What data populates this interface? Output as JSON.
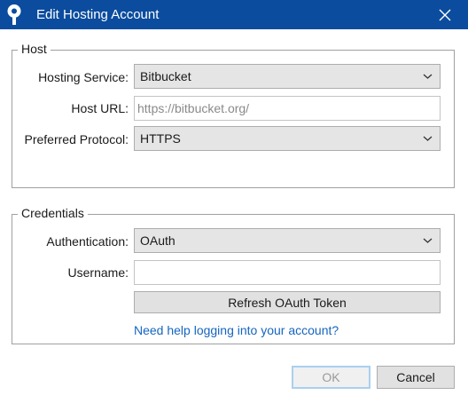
{
  "window": {
    "title": "Edit Hosting Account"
  },
  "icons": {
    "app": "sourcetree-icon",
    "close": "close-icon",
    "dropdown": "chevron-down-icon"
  },
  "colors": {
    "titlebar": "#0b4c9e",
    "link": "#1565c0",
    "ok_border": "#a9d0ef"
  },
  "host_group": {
    "legend": "Host",
    "hosting_service": {
      "label": "Hosting Service:",
      "value": "Bitbucket"
    },
    "host_url": {
      "label": "Host URL:",
      "value": "",
      "placeholder": "https://bitbucket.org/"
    },
    "preferred_protocol": {
      "label": "Preferred Protocol:",
      "value": "HTTPS"
    }
  },
  "credentials_group": {
    "legend": "Credentials",
    "authentication": {
      "label": "Authentication:",
      "value": "OAuth"
    },
    "username": {
      "label": "Username:",
      "value": "",
      "placeholder": ""
    },
    "refresh_button": "Refresh OAuth Token",
    "help_link": "Need help logging into your account?"
  },
  "buttons": {
    "ok": "OK",
    "cancel": "Cancel"
  }
}
